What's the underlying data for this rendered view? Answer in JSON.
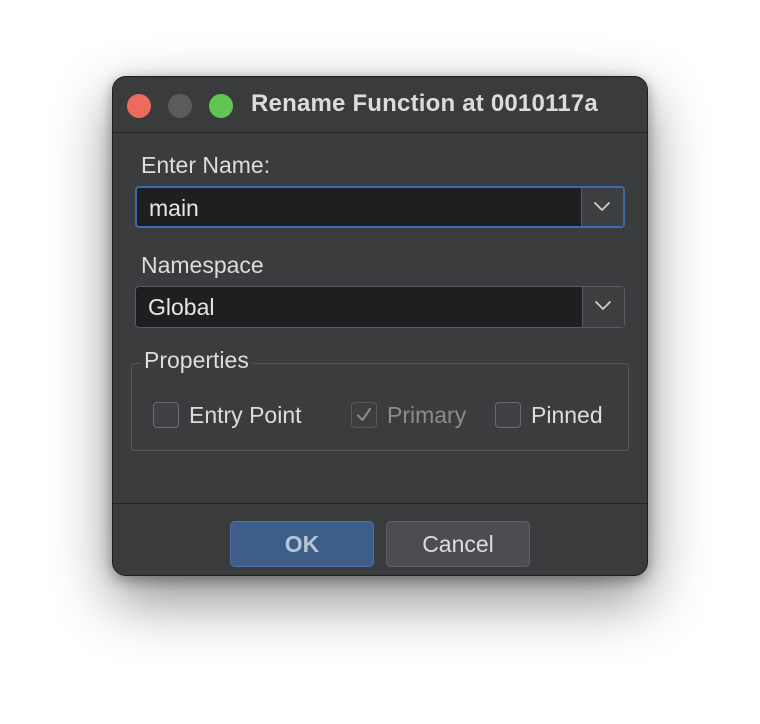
{
  "window": {
    "title": "Rename Function at 0010117a"
  },
  "name_field": {
    "label": "Enter Name:",
    "value": "main"
  },
  "namespace_field": {
    "label": "Namespace",
    "value": "Global"
  },
  "properties": {
    "legend": "Properties",
    "options": [
      {
        "label": "Entry Point",
        "checked": false,
        "enabled": true
      },
      {
        "label": "Primary",
        "checked": true,
        "enabled": false
      },
      {
        "label": "Pinned",
        "checked": false,
        "enabled": true
      }
    ]
  },
  "buttons": {
    "ok_label": "OK",
    "cancel_label": "Cancel"
  },
  "colors": {
    "close": "#ec6a5e",
    "minimize": "#5a5b5d",
    "zoom": "#61c554",
    "accent": "#3e5e8a",
    "focus_ring": "#3e6aa8"
  },
  "icons": {
    "dropdown": "chevron-down-icon",
    "checkmark": "checkmark-icon"
  }
}
